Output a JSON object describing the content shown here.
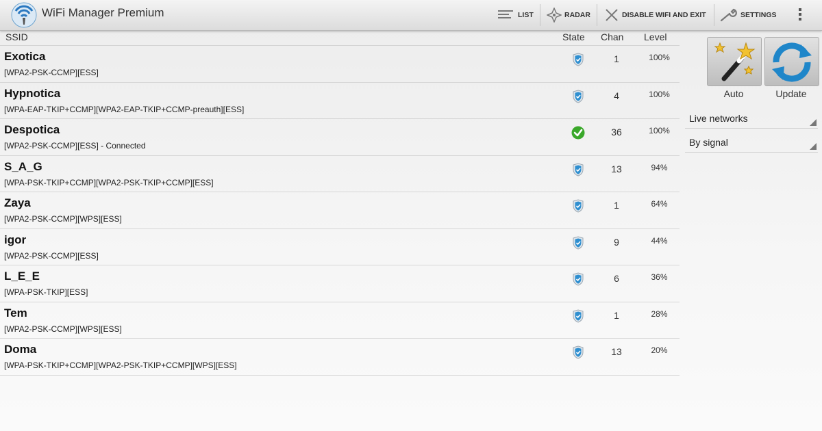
{
  "app": {
    "title": "WiFi Manager Premium"
  },
  "actionbar": {
    "list_label": "LIST",
    "radar_label": "RADAR",
    "disable_label": "DISABLE WIFI AND EXIT",
    "settings_label": "SETTINGS"
  },
  "table": {
    "headers": {
      "ssid": "SSID",
      "state": "State",
      "chan": "Chan",
      "level": "Level"
    },
    "rows": [
      {
        "ssid": "Exotica",
        "caps": "[WPA2-PSK-CCMP][ESS]",
        "state": "secured-shield-icon",
        "chan": "1",
        "level": "100%"
      },
      {
        "ssid": "Hypnotica",
        "caps": "[WPA-EAP-TKIP+CCMP][WPA2-EAP-TKIP+CCMP-preauth][ESS]",
        "state": "secured-shield-icon",
        "chan": "4",
        "level": "100%"
      },
      {
        "ssid": "Despotica",
        "caps": "[WPA2-PSK-CCMP][ESS] - Connected",
        "state": "connected-check-icon",
        "chan": "36",
        "level": "100%"
      },
      {
        "ssid": "S_A_G",
        "caps": "[WPA-PSK-TKIP+CCMP][WPA2-PSK-TKIP+CCMP][ESS]",
        "state": "secured-shield-icon",
        "chan": "13",
        "level": "94%"
      },
      {
        "ssid": "Zaya",
        "caps": "[WPA2-PSK-CCMP][WPS][ESS]",
        "state": "secured-shield-icon",
        "chan": "1",
        "level": "64%"
      },
      {
        "ssid": "igor",
        "caps": "[WPA2-PSK-CCMP][ESS]",
        "state": "secured-shield-icon",
        "chan": "9",
        "level": "44%"
      },
      {
        "ssid": "L_E_E",
        "caps": "[WPA-PSK-TKIP][ESS]",
        "state": "secured-shield-icon",
        "chan": "6",
        "level": "36%"
      },
      {
        "ssid": "Tem",
        "caps": "[WPA2-PSK-CCMP][WPS][ESS]",
        "state": "secured-shield-icon",
        "chan": "1",
        "level": "28%"
      },
      {
        "ssid": "Doma",
        "caps": "[WPA-PSK-TKIP+CCMP][WPA2-PSK-TKIP+CCMP][WPS][ESS]",
        "state": "secured-shield-icon",
        "chan": "13",
        "level": "20%"
      }
    ]
  },
  "panel": {
    "auto_label": "Auto",
    "update_label": "Update",
    "network_filter": "Live networks",
    "sort_order": "By signal"
  },
  "colors": {
    "shield": "#2f8fd0",
    "connected": "#3aa82a"
  }
}
